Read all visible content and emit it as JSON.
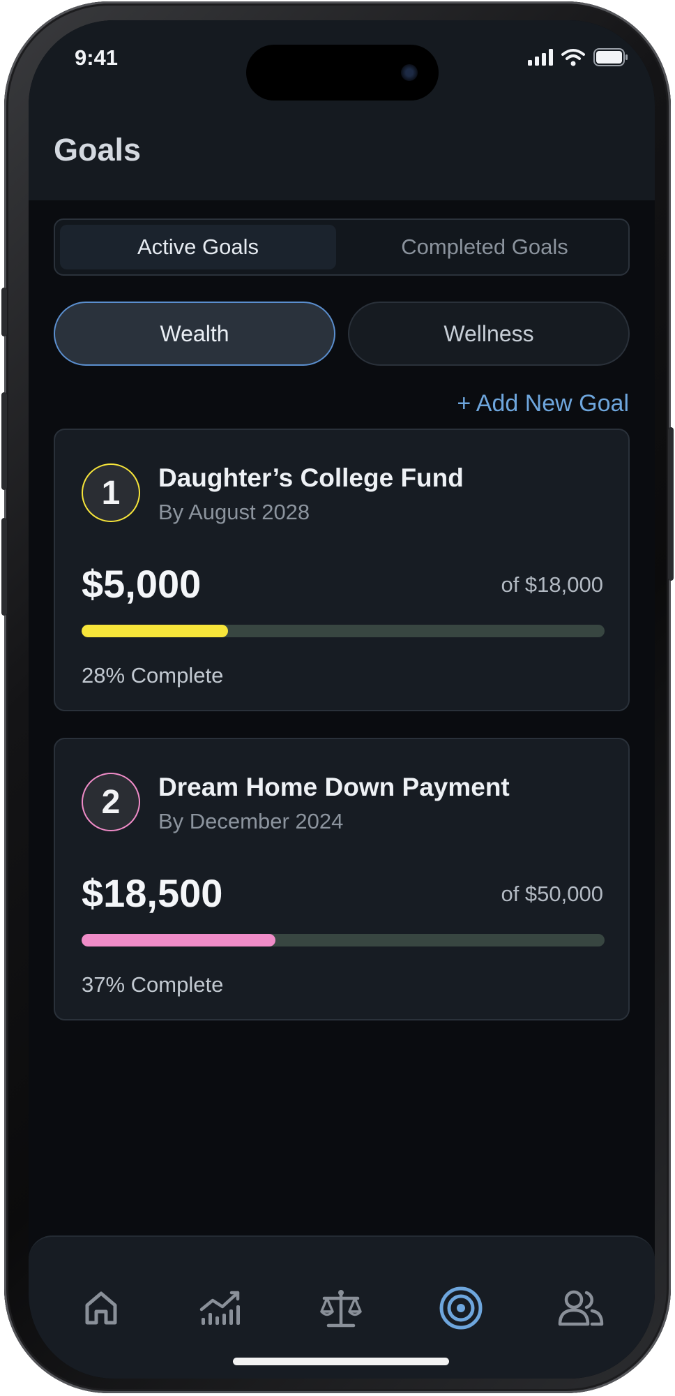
{
  "status_bar": {
    "time": "9:41"
  },
  "header": {
    "title": "Goals"
  },
  "tabs": [
    {
      "label": "Active Goals",
      "active": true
    },
    {
      "label": "Completed Goals",
      "active": false
    }
  ],
  "categories": [
    {
      "label": "Wealth",
      "active": true
    },
    {
      "label": "Wellness",
      "active": false
    }
  ],
  "add_goal_label": "+ Add New Goal",
  "goals": [
    {
      "number": "1",
      "name": "Daughter’s College Fund",
      "due": "By August 2028",
      "saved": "$5,000",
      "target": "of $18,000",
      "progress": 0.28,
      "progress_label": "28% Complete",
      "accent": "#f7e53a"
    },
    {
      "number": "2",
      "name": "Dream Home Down Payment",
      "due": "By December 2024",
      "saved": "$18,500",
      "target": "of $50,000",
      "progress": 0.37,
      "progress_label": "37% Complete",
      "accent": "#f08cc8"
    }
  ],
  "nav": [
    {
      "icon": "home-icon",
      "active": false
    },
    {
      "icon": "chart-icon",
      "active": false
    },
    {
      "icon": "balance-scale-icon",
      "active": false
    },
    {
      "icon": "target-icon",
      "active": true
    },
    {
      "icon": "users-icon",
      "active": false
    }
  ],
  "colors": {
    "active_nav": "#6ea6dd",
    "inactive_nav": "#8a9099",
    "link": "#6ea6dd"
  }
}
